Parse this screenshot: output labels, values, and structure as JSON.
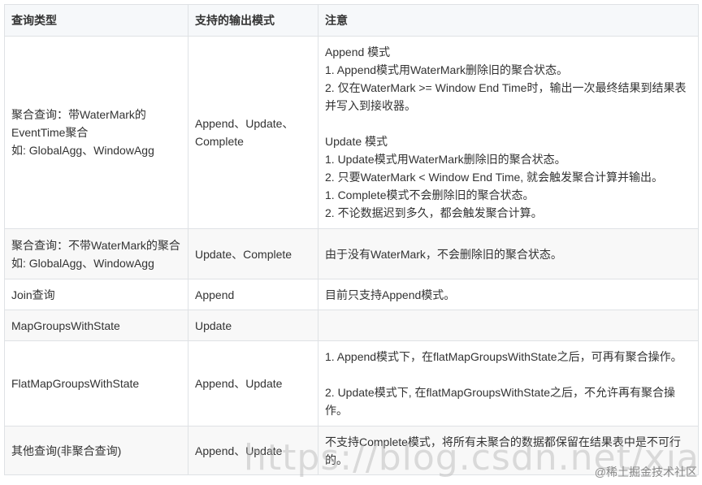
{
  "headers": [
    "查询类型",
    "支持的输出模式",
    "注意"
  ],
  "rows": [
    {
      "type": [
        "聚合查询：带WaterMark的",
        "EventTime聚合",
        "如: GlobalAgg、WindowAgg"
      ],
      "modes": [
        "Append、Update、",
        "Complete"
      ],
      "notes": [
        "Append 模式",
        "1. Append模式用WaterMark删除旧的聚合状态。",
        "2. 仅在WaterMark >= Window End Time时，输出一次最终结果到结果表并写入到接收器。",
        "",
        "Update 模式",
        "1. Update模式用WaterMark删除旧的聚合状态。",
        "2. 只要WaterMark < Window End Time, 就会触发聚合计算并输出。",
        "1. Complete模式不会删除旧的聚合状态。",
        "2. 不论数据迟到多久，都会触发聚合计算。"
      ]
    },
    {
      "type": [
        "聚合查询：不带WaterMark的聚合",
        "如: GlobalAgg、WindowAgg"
      ],
      "modes": [
        "Update、Complete"
      ],
      "notes": [
        "由于没有WaterMark，不会删除旧的聚合状态。"
      ]
    },
    {
      "type": [
        "Join查询"
      ],
      "modes": [
        "Append"
      ],
      "notes": [
        "目前只支持Append模式。"
      ]
    },
    {
      "type": [
        "MapGroupsWithState"
      ],
      "modes": [
        "Update"
      ],
      "notes": []
    },
    {
      "type": [
        "FlatMapGroupsWithState"
      ],
      "modes": [
        "Append、Update"
      ],
      "notes": [
        "1. Append模式下，在flatMapGroupsWithState之后，可再有聚合操作。",
        "",
        "2. Update模式下, 在flatMapGroupsWithState之后，不允许再有聚合操作。"
      ]
    },
    {
      "type": [
        "其他查询(非聚合查询)"
      ],
      "modes": [
        "Append、Update"
      ],
      "notes": [
        "不支持Complete模式，将所有未聚合的数据都保留在结果表中是不可行的。"
      ]
    }
  ],
  "watermark": "https://blog.csdn.net/xianpanjia4616",
  "credit": "@稀土掘金技术社区"
}
